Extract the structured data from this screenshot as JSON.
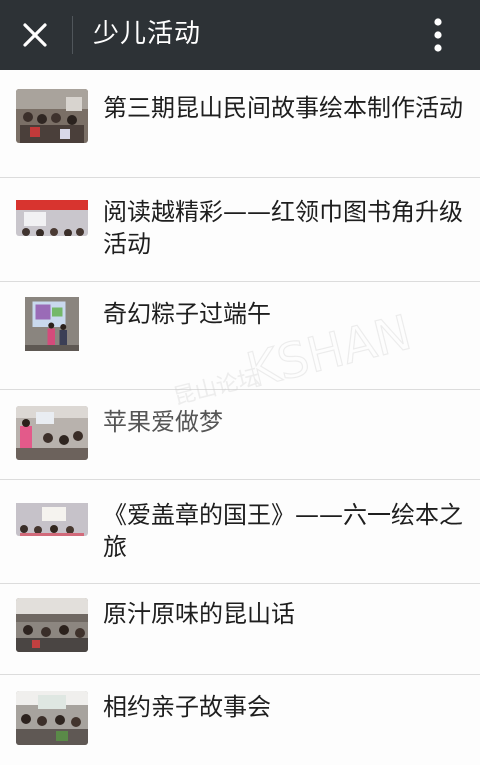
{
  "header": {
    "title": "少儿活动",
    "close_icon": "close-icon",
    "more_icon": "more-vertical-icon"
  },
  "items": [
    {
      "title": "第三期昆山民间故事绘本制作活动"
    },
    {
      "title": "阅读越精彩——红领巾图书角升级活动"
    },
    {
      "title": "奇幻粽子过端午"
    },
    {
      "title": "苹果爱做梦"
    },
    {
      "title": "《爱盖章的国王》——六一绘本之旅"
    },
    {
      "title": "原汁原味的昆山话"
    },
    {
      "title": "相约亲子故事会"
    }
  ],
  "watermark": {
    "text_cn": "昆山论坛",
    "text_en": "KSHAN BBS"
  },
  "colors": {
    "header_bg": "#2d3236",
    "list_bg": "#fdfdfd",
    "divider": "#dcdcdc"
  }
}
